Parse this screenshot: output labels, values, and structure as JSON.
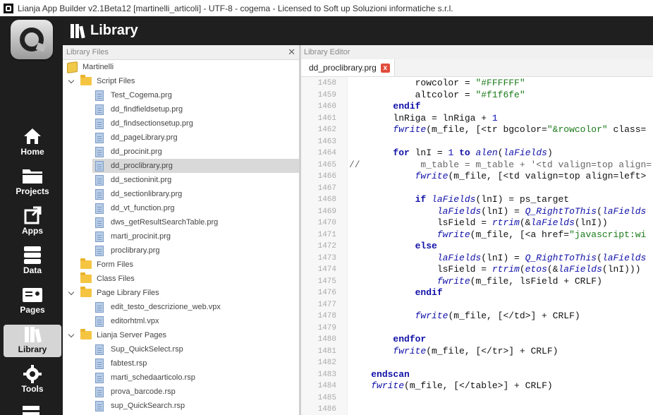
{
  "window": {
    "title": "Lianja App Builder v2.1Beta12 [martinelli_articoli] - UTF-8 - cogema - Licensed to Soft up Soluzioni informatiche s.r.l."
  },
  "header": {
    "title": "Library"
  },
  "nav": [
    {
      "label": "Home",
      "icon": "home-icon"
    },
    {
      "label": "Projects",
      "icon": "folder-icon"
    },
    {
      "label": "Apps",
      "icon": "apps-icon"
    },
    {
      "label": "Data",
      "icon": "database-icon"
    },
    {
      "label": "Pages",
      "icon": "pages-icon"
    },
    {
      "label": "Library",
      "icon": "library-icon",
      "active": true
    },
    {
      "label": "Tools",
      "icon": "gear-icon"
    }
  ],
  "library_files": {
    "header": "Library Files",
    "rows": [
      {
        "label": "Martinelli",
        "kind": "root",
        "depth": 0
      },
      {
        "label": "Script Files",
        "kind": "folder",
        "depth": 1,
        "expanded": true
      },
      {
        "label": "Test_Cogema.prg",
        "kind": "file",
        "depth": 2
      },
      {
        "label": "dd_findfieldsetup.prg",
        "kind": "file",
        "depth": 2
      },
      {
        "label": "dd_findsectionsetup.prg",
        "kind": "file",
        "depth": 2
      },
      {
        "label": "dd_pageLibrary.prg",
        "kind": "file",
        "depth": 2
      },
      {
        "label": "dd_procinit.prg",
        "kind": "file",
        "depth": 2
      },
      {
        "label": "dd_proclibrary.prg",
        "kind": "file",
        "depth": 2,
        "selected": true
      },
      {
        "label": "dd_sectioninit.prg",
        "kind": "file",
        "depth": 2
      },
      {
        "label": "dd_sectionlibrary.prg",
        "kind": "file",
        "depth": 2
      },
      {
        "label": "dd_vt_function.prg",
        "kind": "file",
        "depth": 2
      },
      {
        "label": "dws_getResultSearchTable.prg",
        "kind": "file",
        "depth": 2
      },
      {
        "label": "marti_procinit.prg",
        "kind": "file",
        "depth": 2
      },
      {
        "label": "proclibrary.prg",
        "kind": "file",
        "depth": 2
      },
      {
        "label": "Form Files",
        "kind": "folder",
        "depth": 1
      },
      {
        "label": "Class Files",
        "kind": "folder",
        "depth": 1
      },
      {
        "label": "Page Library Files",
        "kind": "folder",
        "depth": 1,
        "expanded": true
      },
      {
        "label": "edit_testo_descrizione_web.vpx",
        "kind": "file",
        "depth": 2
      },
      {
        "label": "editorhtml.vpx",
        "kind": "file",
        "depth": 2
      },
      {
        "label": "Lianja Server Pages",
        "kind": "folder",
        "depth": 1,
        "expanded": true
      },
      {
        "label": "Sup_QuickSelect.rsp",
        "kind": "file",
        "depth": 2
      },
      {
        "label": "fabtest.rsp",
        "kind": "file",
        "depth": 2
      },
      {
        "label": "marti_schedaarticolo.rsp",
        "kind": "file",
        "depth": 2
      },
      {
        "label": "prova_barcode.rsp",
        "kind": "file",
        "depth": 2
      },
      {
        "label": "sup_QuickSearch.rsp",
        "kind": "file",
        "depth": 2
      }
    ]
  },
  "editor": {
    "header": "Library Editor",
    "tab": {
      "label": "dd_proclibrary.prg",
      "close": "x"
    },
    "lines": [
      {
        "n": "1458",
        "text": "            rowcolor = \"#FFFFFF\""
      },
      {
        "n": "1459",
        "text": "            altcolor = \"#f1f6fe\""
      },
      {
        "n": "1460",
        "text": "        endif"
      },
      {
        "n": "1461",
        "text": "        lnRiga = lnRiga + 1"
      },
      {
        "n": "1462",
        "text": "        fwrite(m_file, [<tr bgcolor=\"&rowcolor\" class="
      },
      {
        "n": "1463",
        "text": ""
      },
      {
        "n": "1464",
        "text": "        for lnI = 1 to alen(laFields)"
      },
      {
        "n": "1465",
        "comment": "//           m_table = m_table + '<td valign=top align="
      },
      {
        "n": "1466",
        "text": "            fwrite(m_file, [<td valign=top align=left>"
      },
      {
        "n": "1467",
        "text": ""
      },
      {
        "n": "1468",
        "text": "            if laFields(lnI) = ps_target"
      },
      {
        "n": "1469",
        "text": "                laFields(lnI) = Q_RightToThis(laFields"
      },
      {
        "n": "1470",
        "text": "                lsField = rtrim(&laFields(lnI))"
      },
      {
        "n": "1471",
        "text": "                fwrite(m_file, [<a href=\"javascript:wi"
      },
      {
        "n": "1472",
        "text": "            else"
      },
      {
        "n": "1473",
        "text": "                laFields(lnI) = Q_RightToThis(laFields"
      },
      {
        "n": "1474",
        "text": "                lsField = rtrim(etos(&laFields(lnI)))"
      },
      {
        "n": "1475",
        "text": "                fwrite(m_file, lsField + CRLF)"
      },
      {
        "n": "1476",
        "text": "            endif"
      },
      {
        "n": "1477",
        "text": ""
      },
      {
        "n": "1478",
        "text": "            fwrite(m_file, [</td>] + CRLF)"
      },
      {
        "n": "1479",
        "text": ""
      },
      {
        "n": "1480",
        "text": "        endfor"
      },
      {
        "n": "1481",
        "text": "        fwrite(m_file, [</tr>] + CRLF)"
      },
      {
        "n": "1482",
        "text": ""
      },
      {
        "n": "1483",
        "text": "    endscan"
      },
      {
        "n": "1484",
        "text": "    fwrite(m_file, [</table>] + CRLF)"
      },
      {
        "n": "1485",
        "text": ""
      },
      {
        "n": "1486",
        "text": ""
      }
    ]
  }
}
